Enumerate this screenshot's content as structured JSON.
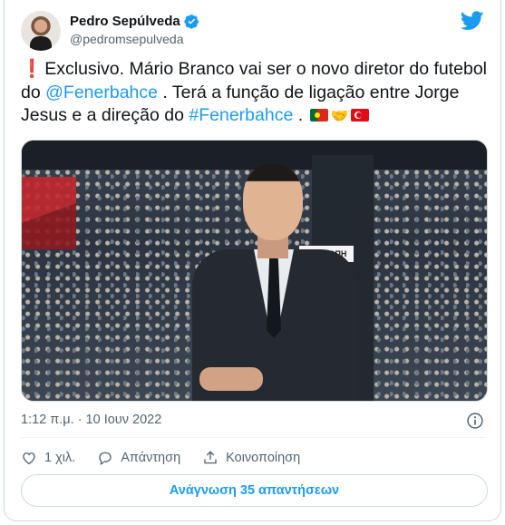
{
  "author": {
    "display_name": "Pedro Sepúlveda",
    "handle": "@pedromsepulveda",
    "verified": true
  },
  "brand": {
    "logo_icon": "twitter-bird-icon",
    "accent_color": "#1d9bf0"
  },
  "tweet": {
    "part1": "Exclusivo. Mário Branco vai ser o novo diretor do futebol do ",
    "mention": "@Fenerbahce",
    "part2": " . Terá a função de ligação entre Jorge Jesus e a direção do ",
    "hashtag": "#Fenerbahce",
    "part3": " . "
  },
  "media": {
    "sign_text": "ΧΟΥΡΟΠΗ"
  },
  "meta": {
    "timestamp": "1:12 π.μ. · 10 Ιουν 2022"
  },
  "actions": {
    "like_count": "1 χιλ.",
    "reply_label": "Απάντηση",
    "share_label": "Κοινοποίηση"
  },
  "read_replies_label": "Ανάγνωση 35 απαντήσεων"
}
